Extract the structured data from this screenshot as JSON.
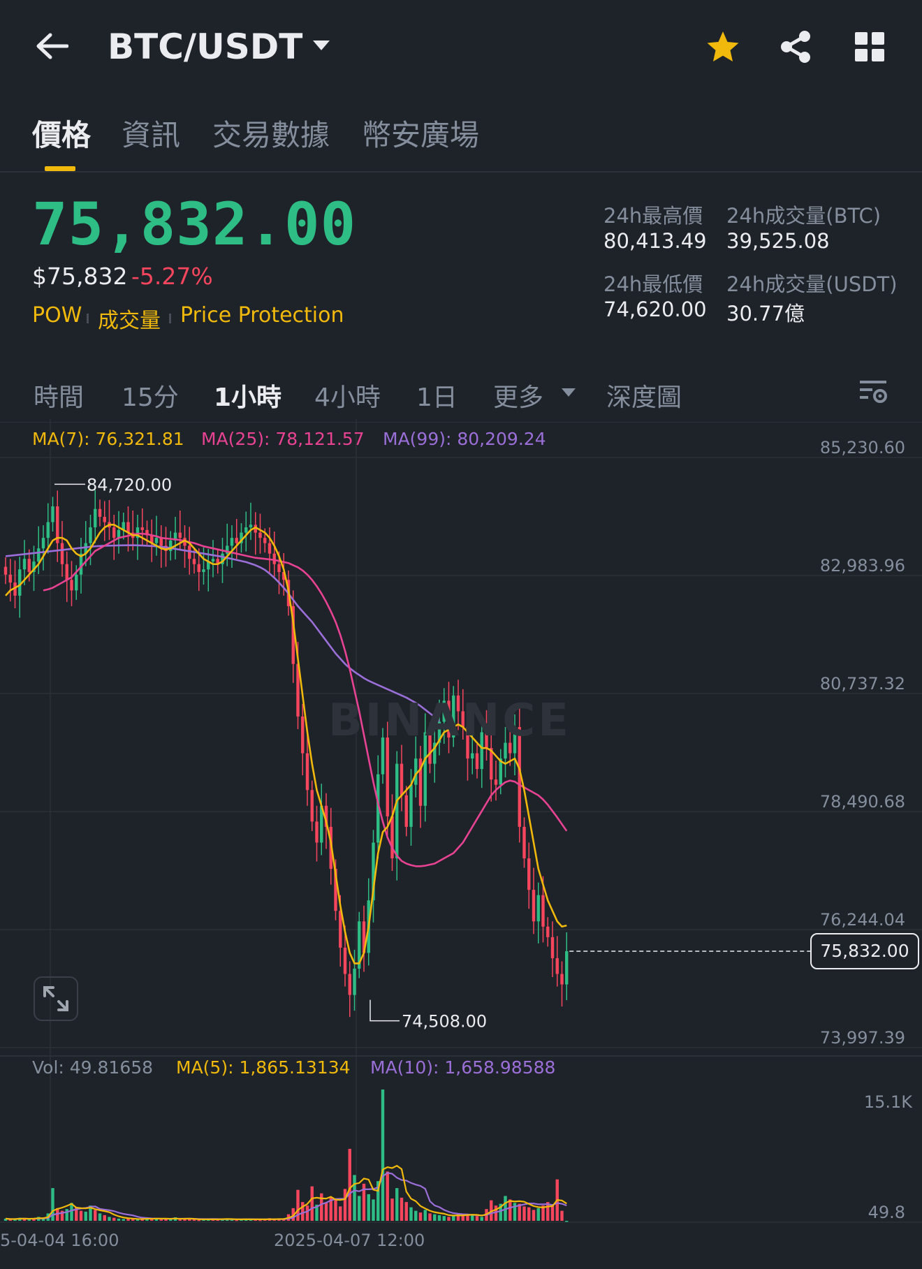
{
  "header": {
    "title": "BTC/USDT",
    "icons": [
      "back-arrow-icon",
      "dropdown-caret-icon",
      "star-icon",
      "share-icon",
      "grid-icon"
    ],
    "star_color": "#f0b90b"
  },
  "tabs": [
    {
      "label": "價格",
      "active": true
    },
    {
      "label": "資訊",
      "active": false
    },
    {
      "label": "交易數據",
      "active": false
    },
    {
      "label": "幣安廣場",
      "active": false
    }
  ],
  "price": {
    "last": "75,832.00",
    "usd": "$75,832",
    "change": "-5.27%",
    "up_color": "#2ebd85",
    "down_color": "#f6465d"
  },
  "tags": [
    "POW",
    "成交量",
    "Price Protection"
  ],
  "stats": {
    "high_label": "24h最高價",
    "high_value": "80,413.49",
    "low_label": "24h最低價",
    "low_value": "74,620.00",
    "vol_btc_label": "24h成交量(BTC)",
    "vol_btc_value": "39,525.08",
    "vol_usdt_label": "24h成交量(USDT)",
    "vol_usdt_value": "30.77億"
  },
  "intervals": [
    {
      "label": "時間",
      "active": false
    },
    {
      "label": "15分",
      "active": false
    },
    {
      "label": "1小時",
      "active": true
    },
    {
      "label": "4小時",
      "active": false
    },
    {
      "label": "1日",
      "active": false
    },
    {
      "label": "更多",
      "active": false
    },
    {
      "label": "深度圖",
      "active": false
    }
  ],
  "chart_data": {
    "type": "candlestick",
    "pair": "BTC/USDT",
    "interval": "1小時",
    "watermark": "BINANCE",
    "ma_legend": {
      "ma7": "MA(7): 76,321.81",
      "ma25": "MA(25): 78,121.57",
      "ma99": "MA(99): 80,209.24",
      "ma7_color": "#f0b90b",
      "ma25_color": "#e84393",
      "ma99_color": "#9b6fd8"
    },
    "y_ticks": [
      "85,230.60",
      "82,983.96",
      "80,737.32",
      "78,490.68",
      "76,244.04",
      "73,997.39"
    ],
    "ylim": [
      73997.39,
      85230.6
    ],
    "high_marker": {
      "label": "84,720.00",
      "value": 84720
    },
    "low_marker": {
      "label": "74,508.00",
      "value": 74508
    },
    "current_price": {
      "label": "75,832.00",
      "value": 75832
    },
    "closes": [
      83000,
      82850,
      82600,
      83100,
      83300,
      83050,
      83250,
      83500,
      83700,
      84000,
      84300,
      83600,
      83200,
      82900,
      82700,
      83000,
      83400,
      83600,
      83900,
      84250,
      84100,
      84000,
      83900,
      83700,
      83850,
      84000,
      83800,
      83700,
      83900,
      83850,
      83750,
      83600,
      83700,
      83550,
      83450,
      83650,
      83800,
      83700,
      83550,
      83300,
      83200,
      83050,
      83100,
      83250,
      83300,
      83200,
      83400,
      83550,
      83700,
      83600,
      83800,
      83900,
      83950,
      83800,
      83700,
      83600,
      83400,
      83200,
      83050,
      82900,
      82400,
      81300,
      80300,
      79600,
      78900,
      78300,
      77900,
      78600,
      78200,
      77400,
      76600,
      75900,
      75400,
      75000,
      75500,
      76400,
      75800,
      76800,
      77900,
      79200,
      79900,
      78400,
      77600,
      79400,
      78800,
      78200,
      79000,
      79500,
      78600,
      80000,
      79400,
      79800,
      80200,
      80600,
      79900,
      80700,
      80400,
      80100,
      79500,
      79600,
      79300,
      80000,
      79700,
      79100,
      79000,
      79500,
      79800,
      79600,
      80100,
      78200,
      77600,
      77000,
      76400,
      76900,
      76300,
      76100,
      75700,
      75400,
      75200,
      75832
    ],
    "ma7": [
      82600,
      82700,
      82750,
      82800,
      82900,
      83000,
      83100,
      83200,
      83350,
      83500,
      83650,
      83700,
      83700,
      83650,
      83500,
      83400,
      83350,
      83400,
      83500,
      83650,
      83800,
      83900,
      83950,
      83950,
      83900,
      83850,
      83800,
      83750,
      83750,
      83700,
      83650,
      83600,
      83550,
      83500,
      83480,
      83500,
      83550,
      83600,
      83650,
      83600,
      83500,
      83400,
      83300,
      83250,
      83200,
      83200,
      83250,
      83350,
      83450,
      83550,
      83650,
      83750,
      83850,
      83900,
      83850,
      83800,
      83700,
      83550,
      83350,
      83100,
      82700,
      82100,
      81400,
      80700,
      80000,
      79400,
      78900,
      78600,
      78300,
      77900,
      77300,
      76700,
      76200,
      75800,
      75600,
      75600,
      75800,
      76300,
      77000,
      77700,
      78100,
      78200,
      78400,
      78700,
      78800,
      78900,
      79000,
      79200,
      79300,
      79500,
      79600,
      79700,
      79850,
      80000,
      80050,
      80100,
      80150,
      80100,
      80000,
      79900,
      79800,
      79700,
      79700,
      79650,
      79550,
      79450,
      79400,
      79450,
      79500,
      79300,
      78900,
      78400,
      77900,
      77400,
      77100,
      76800,
      76600,
      76400,
      76300,
      76322
    ],
    "ma25": [
      82700,
      82720,
      82750,
      82800,
      82850,
      82900,
      82950,
      83050,
      83150,
      83250,
      83350,
      83450,
      83500,
      83550,
      83600,
      83650,
      83700,
      83720,
      83740,
      83760,
      83780,
      83780,
      83770,
      83750,
      83730,
      83700,
      83690,
      83680,
      83670,
      83660,
      83640,
      83620,
      83600,
      83570,
      83540,
      83520,
      83500,
      83480,
      83460,
      83440,
      83420,
      83400,
      83380,
      83360,
      83340,
      83320,
      83310,
      83300,
      83290,
      83280,
      83260,
      83240,
      83220,
      83180,
      83140,
      83080,
      83000,
      82900,
      82780,
      82640,
      82480,
      82300,
      82100,
      81850,
      81550,
      81200,
      80800,
      80400,
      79950,
      79500,
      79050,
      78650,
      78300,
      78000,
      77800,
      77650,
      77550,
      77500,
      77470,
      77450,
      77450,
      77460,
      77480,
      77500,
      77550,
      77600,
      77650,
      77700,
      77800,
      77900,
      78050,
      78200,
      78350,
      78500,
      78650,
      78800,
      78900,
      78980,
      79050,
      79080,
      79060,
      79000,
      78950,
      78900,
      78850,
      78800,
      78720,
      78620,
      78500,
      78380,
      78250,
      78121
    ],
    "ma99": [
      83350,
      83360,
      83370,
      83380,
      83390,
      83400,
      83410,
      83420,
      83430,
      83440,
      83450,
      83460,
      83470,
      83480,
      83490,
      83500,
      83510,
      83520,
      83530,
      83540,
      83545,
      83550,
      83552,
      83554,
      83556,
      83558,
      83560,
      83560,
      83558,
      83555,
      83550,
      83545,
      83540,
      83530,
      83520,
      83505,
      83490,
      83475,
      83460,
      83445,
      83430,
      83415,
      83400,
      83385,
      83370,
      83355,
      83340,
      83320,
      83300,
      83280,
      83260,
      83240,
      83210,
      83180,
      83140,
      83090,
      83020,
      82940,
      82850,
      82750,
      82640,
      82520,
      82400,
      82300,
      82200,
      82100,
      81980,
      81860,
      81740,
      81620,
      81500,
      81400,
      81300,
      81220,
      81150,
      81090,
      81030,
      80980,
      80940,
      80900,
      80860,
      80820,
      80780,
      80740,
      80700,
      80660,
      80610,
      80560,
      80500,
      80430,
      80360,
      80290,
      80209
    ],
    "x_labels": [
      "5-04-04 16:00",
      "2025-04-07 12:00"
    ],
    "volume": {
      "vol_legend": "Vol: 49.81658",
      "ma5_legend": "MA(5): 1,865.13134",
      "ma10_legend": "MA(10): 1,658.98588",
      "y_ticks": [
        "15.1K",
        "49.8"
      ],
      "ylim": [
        49.8,
        15100
      ],
      "values": [
        300,
        200,
        250,
        400,
        350,
        200,
        300,
        500,
        400,
        900,
        3800,
        1500,
        1200,
        1400,
        2100,
        1600,
        1200,
        1100,
        1800,
        1300,
        900,
        700,
        500,
        400,
        300,
        250,
        300,
        280,
        200,
        250,
        400,
        300,
        350,
        200,
        250,
        300,
        450,
        200,
        250,
        300,
        200,
        150,
        200,
        250,
        300,
        200,
        250,
        300,
        200,
        150,
        200,
        300,
        250,
        200,
        150,
        200,
        350,
        250,
        300,
        200,
        800,
        1500,
        3600,
        2200,
        1800,
        4000,
        1900,
        3200,
        2100,
        2800,
        2400,
        1700,
        3700,
        8300,
        5300,
        2900,
        4300,
        3100,
        2500,
        4600,
        15100,
        5700,
        2600,
        3800,
        2700,
        2200,
        1600,
        1200,
        1000,
        1300,
        900,
        800,
        700,
        600,
        500,
        700,
        900,
        650,
        800,
        700,
        600,
        500,
        1400,
        2400,
        1800,
        2000,
        2900,
        2500,
        2100,
        2000,
        1700,
        1600,
        1300,
        1500,
        1800,
        2200,
        1900,
        4800,
        1200,
        50
      ]
    }
  },
  "vol_colors": [
    "up",
    "down",
    "up",
    "up",
    "down",
    "up",
    "down",
    "up",
    "up",
    "up",
    "up",
    "down",
    "down",
    "up",
    "up",
    "down",
    "down",
    "up",
    "up",
    "down",
    "up",
    "down",
    "up",
    "down",
    "up",
    "up",
    "down",
    "down",
    "up",
    "down",
    "up",
    "down",
    "up",
    "down",
    "down",
    "up",
    "up",
    "down",
    "down",
    "down",
    "down",
    "down",
    "up",
    "up",
    "down",
    "down",
    "up",
    "up",
    "up",
    "down",
    "up",
    "up",
    "up",
    "down",
    "down",
    "down",
    "down",
    "down",
    "down",
    "down",
    "down",
    "down",
    "down",
    "down",
    "down",
    "down",
    "up",
    "down",
    "down",
    "down",
    "down",
    "down",
    "down",
    "down",
    "up",
    "up",
    "down",
    "up",
    "up",
    "up",
    "up",
    "down",
    "down",
    "up",
    "down",
    "down",
    "up",
    "up",
    "down",
    "up",
    "down",
    "up",
    "up",
    "up",
    "down",
    "up",
    "down",
    "down",
    "down",
    "up",
    "down",
    "up",
    "down",
    "down",
    "down",
    "up",
    "up",
    "down",
    "up",
    "down",
    "down",
    "down",
    "down",
    "up",
    "down",
    "down",
    "down",
    "down",
    "down",
    "up"
  ]
}
